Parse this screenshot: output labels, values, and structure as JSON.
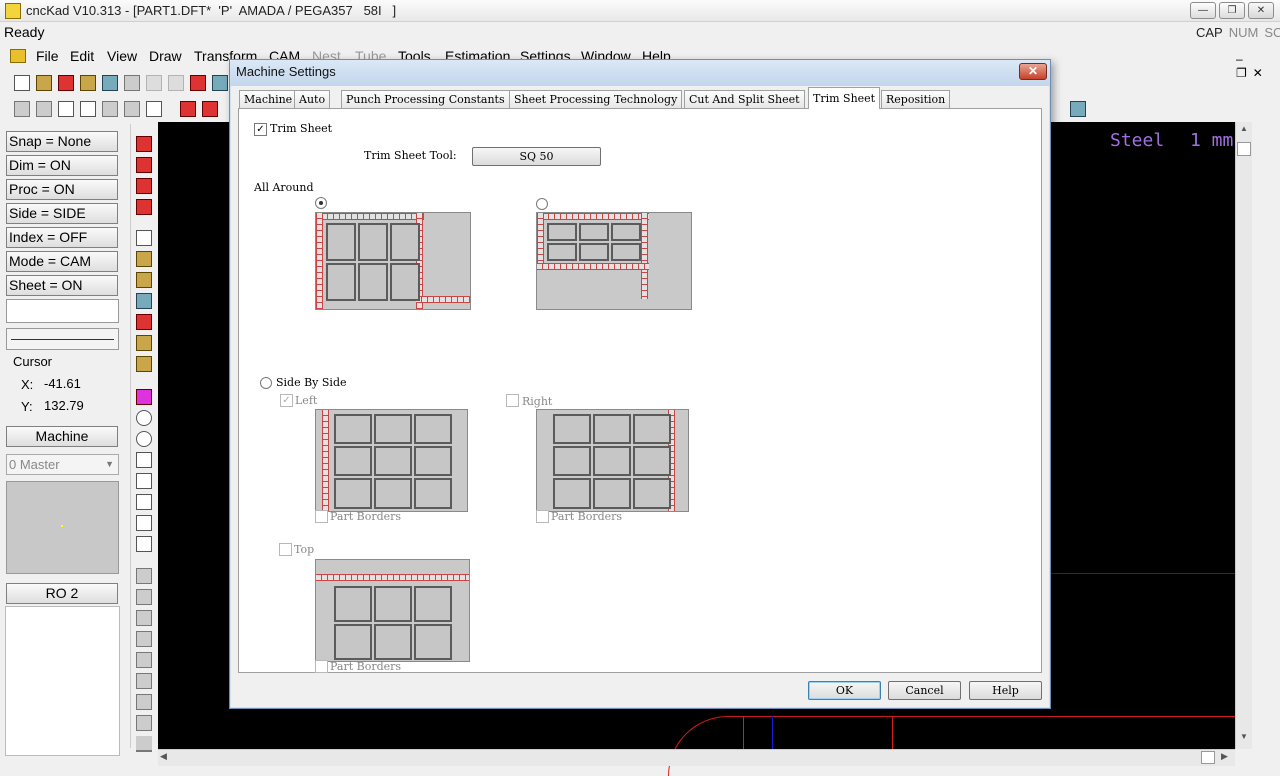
{
  "app": {
    "title": "cncKad V10.313 - [PART1.DFT*  'P'  AMADA / PEGA357   58I   ]",
    "status": "Ready",
    "indicators": [
      "CAP",
      "NUM",
      "SCRL"
    ],
    "window_controls": [
      "minimize",
      "restore",
      "close"
    ]
  },
  "menu": [
    "File",
    "Edit",
    "View",
    "Draw",
    "Transform",
    "CAM",
    "Nest",
    "Tube",
    "Tools",
    "Estimation",
    "Settings",
    "Window",
    "Help"
  ],
  "left_panel": {
    "buttons": [
      "Snap = None",
      "Dim  = ON",
      "Proc = ON",
      "Side  = SIDE",
      "Index = OFF",
      "Mode = CAM",
      "Sheet = ON"
    ],
    "cursor_title": "Cursor",
    "x_label": "X:",
    "x_value": "-41.61",
    "y_label": "Y:",
    "y_value": "132.79",
    "machine_button": "Machine",
    "master_select": "0 Master",
    "ro_button": "RO 2"
  },
  "canvas": {
    "material": "Steel",
    "thickness": "1 mm",
    "colors": {
      "background": "#000000",
      "material_text": "#a070e0",
      "line_blue": "#1a1ad0",
      "line_red": "#d02020"
    }
  },
  "dialog": {
    "title": "Machine Settings",
    "tabs": [
      "Machine",
      "Auto",
      "Punch Processing Constants",
      "Sheet Processing Technology",
      "Cut And Split Sheet",
      "Trim Sheet",
      "Reposition"
    ],
    "active_tab": "Trim Sheet",
    "trim_sheet_label": "Trim Sheet",
    "trim_sheet_checked": true,
    "tool_label": "Trim Sheet Tool:",
    "tool_value": "SQ 50",
    "all_around_label": "All Around",
    "side_by_side_label": "Side By Side",
    "left_label": "Left",
    "right_label": "Right",
    "top_label": "Top",
    "part_borders_label": "Part Borders",
    "buttons": {
      "ok": "OK",
      "cancel": "Cancel",
      "help": "Help"
    }
  }
}
